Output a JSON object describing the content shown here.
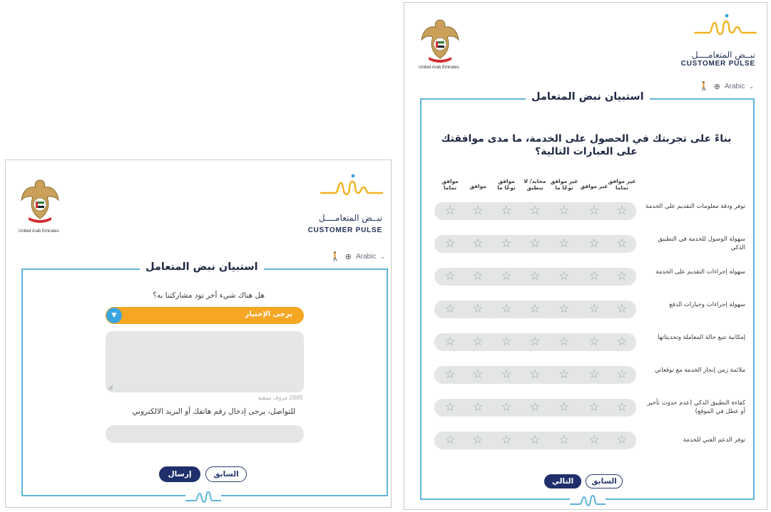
{
  "emblem_caption": "United Arab Emirates",
  "logo": {
    "arabic": "نبــض المتعامــــل",
    "english": "CUSTOMER PULSE"
  },
  "language": "Arabic",
  "survey_title": "استبيان نبض المتعامل",
  "left": {
    "question": "هل هناك شيء أخر تود مشاركتنا به؟",
    "select_placeholder": "يرجى الإختيار",
    "char_limit": "2000 حروف متبقية",
    "contact_label": "للتواصل، يرجى إدخال رقم هاتفك أو البريد الالكتروني",
    "prev_label": "السابق",
    "submit_label": "إرسال"
  },
  "right": {
    "question": "بناءً على تجربتك في الحصول على الخدمة، ما مدى موافقتك على العبارات التالية؟",
    "columns": [
      "غير موافق تماما",
      "غير موافق",
      "غير موافق نوعًا ما",
      "محايد/ لا ينطبق",
      "موافق نوعًا ما",
      "موافق",
      "موافق تماما"
    ],
    "rows": [
      "توفر ودقة معلومات التقديم على الخدمة",
      "سهولة الوصول للخدمة في التطبيق الذكي",
      "سهولة إجراءات التقديم على الخدمة",
      "سهولة إجراءات وخيارات الدفع",
      "إمكانية تتبع حالة المعاملة وتحديثاتها",
      "ملائمة زمن إنجاز الخدمة مع توقعاتي",
      "كفاءة التطبيق الذكي (عدم حدوث تأخير أو عطل في الموقع)",
      "توفر الدعم الفني للخدمة"
    ],
    "prev_label": "السابق",
    "next_label": "التالي"
  },
  "colors": {
    "accent_orange": "#f5a623",
    "frame_blue": "#5fb5de",
    "navy": "#1f2f6b",
    "logo_gold": "#f0b323"
  },
  "icons": [
    "uae-emblem-icon",
    "customer-pulse-logo-icon",
    "accessibility-icon",
    "globe-icon",
    "chevron-down-icon",
    "star-icon",
    "resize-handle-icon",
    "pulse-wave-icon"
  ]
}
